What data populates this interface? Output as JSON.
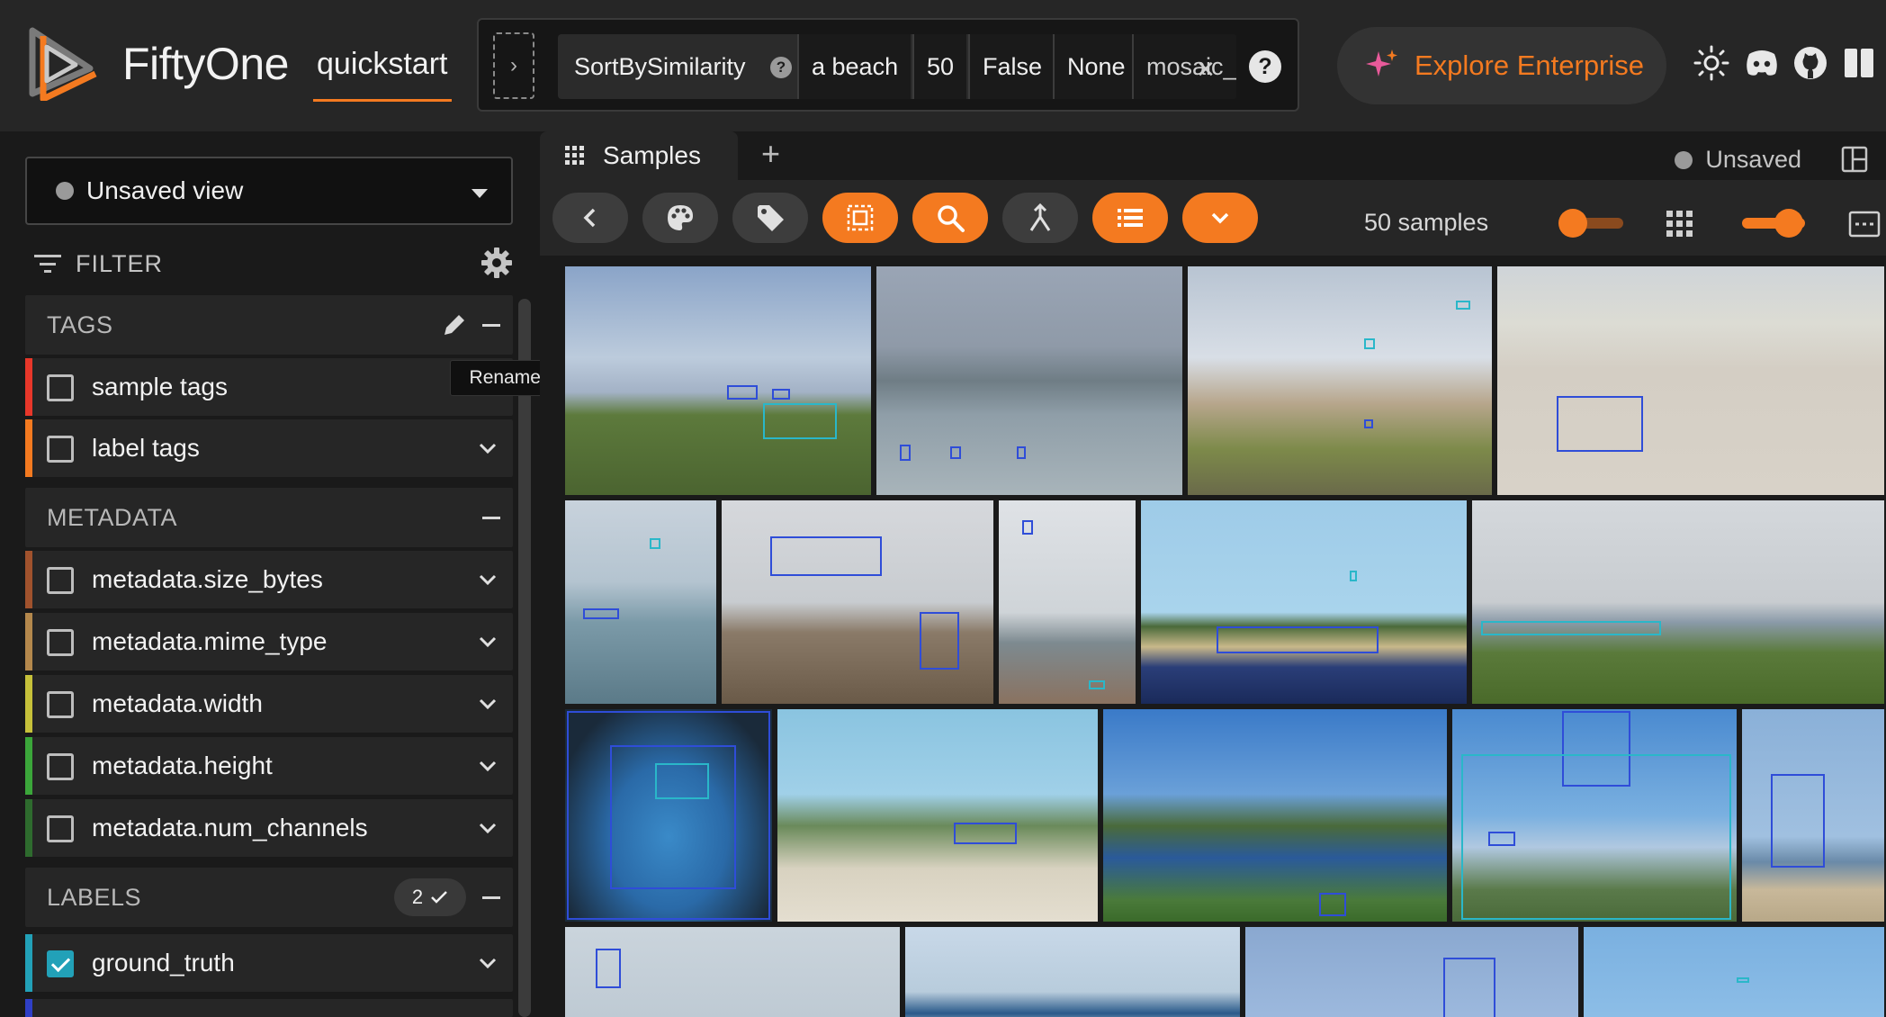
{
  "header": {
    "brand": "FiftyOne",
    "dataset": "quickstart",
    "stage": {
      "name": "SortBySimilarity",
      "params": [
        "a beach",
        "50",
        "False",
        "None",
        "mosaic_le"
      ]
    },
    "enterprise_label": "Explore Enterprise"
  },
  "sidebar": {
    "view_select": "Unsaved view",
    "filter_label": "FILTER",
    "tooltip": "Rename group",
    "groups": {
      "tags": {
        "label": "TAGS",
        "items": [
          "sample tags",
          "label tags"
        ]
      },
      "metadata": {
        "label": "METADATA",
        "items": [
          "metadata.size_bytes",
          "metadata.mime_type",
          "metadata.width",
          "metadata.height",
          "metadata.num_channels"
        ]
      },
      "labels": {
        "label": "LABELS",
        "badge_count": "2",
        "items": [
          "ground_truth"
        ]
      }
    },
    "row_colors": [
      "#e8372a",
      "#f47a20",
      "#a0522d",
      "#b4884c",
      "#c6c13a",
      "#3ba63a",
      "#2e6b2e",
      "#22a1b8"
    ]
  },
  "main": {
    "tab_label": "Samples",
    "status": "Unsaved",
    "sample_count": "50 samples"
  }
}
